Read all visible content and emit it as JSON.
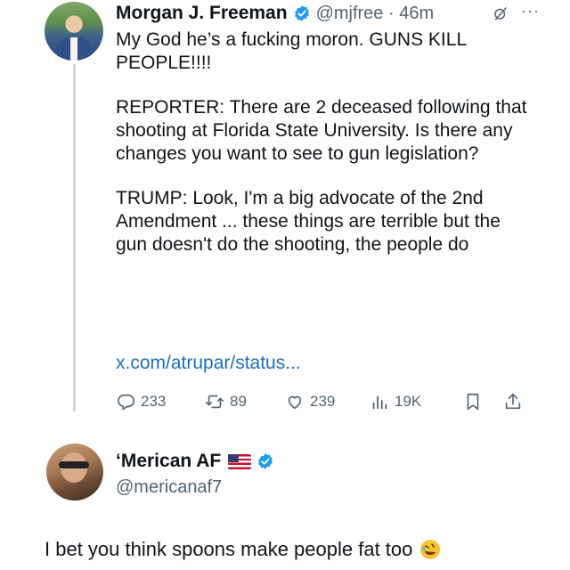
{
  "tweet": {
    "author_name": "Morgan J. Freeman",
    "handle_time": "@mjfree · 46m",
    "more": "···",
    "text": [
      "My God he’s a fucking moron. GUNS KILL PEOPLE!!!!",
      "REPORTER: There are 2 deceased following that shooting at Florida State University. Is there any changes you want to see to gun legislation?",
      "TRUMP: Look, I'm a big advocate of the 2nd Amendment ... these things are terrible but the gun doesn't do the shooting, the people do"
    ],
    "link": "x.com/atrupar/status...",
    "actions": {
      "replies": "233",
      "reposts": "89",
      "likes": "239",
      "views": "19K"
    }
  },
  "reply": {
    "author_name": "‘Merican AF",
    "handle": "@mericanaf7",
    "text": "I bet you think spoons make people fat too"
  },
  "icons": {
    "verified": "verified-badge-icon",
    "grok": "grok-icon",
    "reply": "comment-icon",
    "repost": "repost-icon",
    "like": "heart-icon",
    "views": "views-icon",
    "bookmark": "bookmark-icon",
    "share": "share-icon",
    "flag": "us-flag-icon",
    "emoji": "rolling-laughing-emoji-icon"
  },
  "colors": {
    "verified_blue": "#1d9bf0",
    "link_blue": "#1d6fb8",
    "secondary_text": "#536471"
  }
}
